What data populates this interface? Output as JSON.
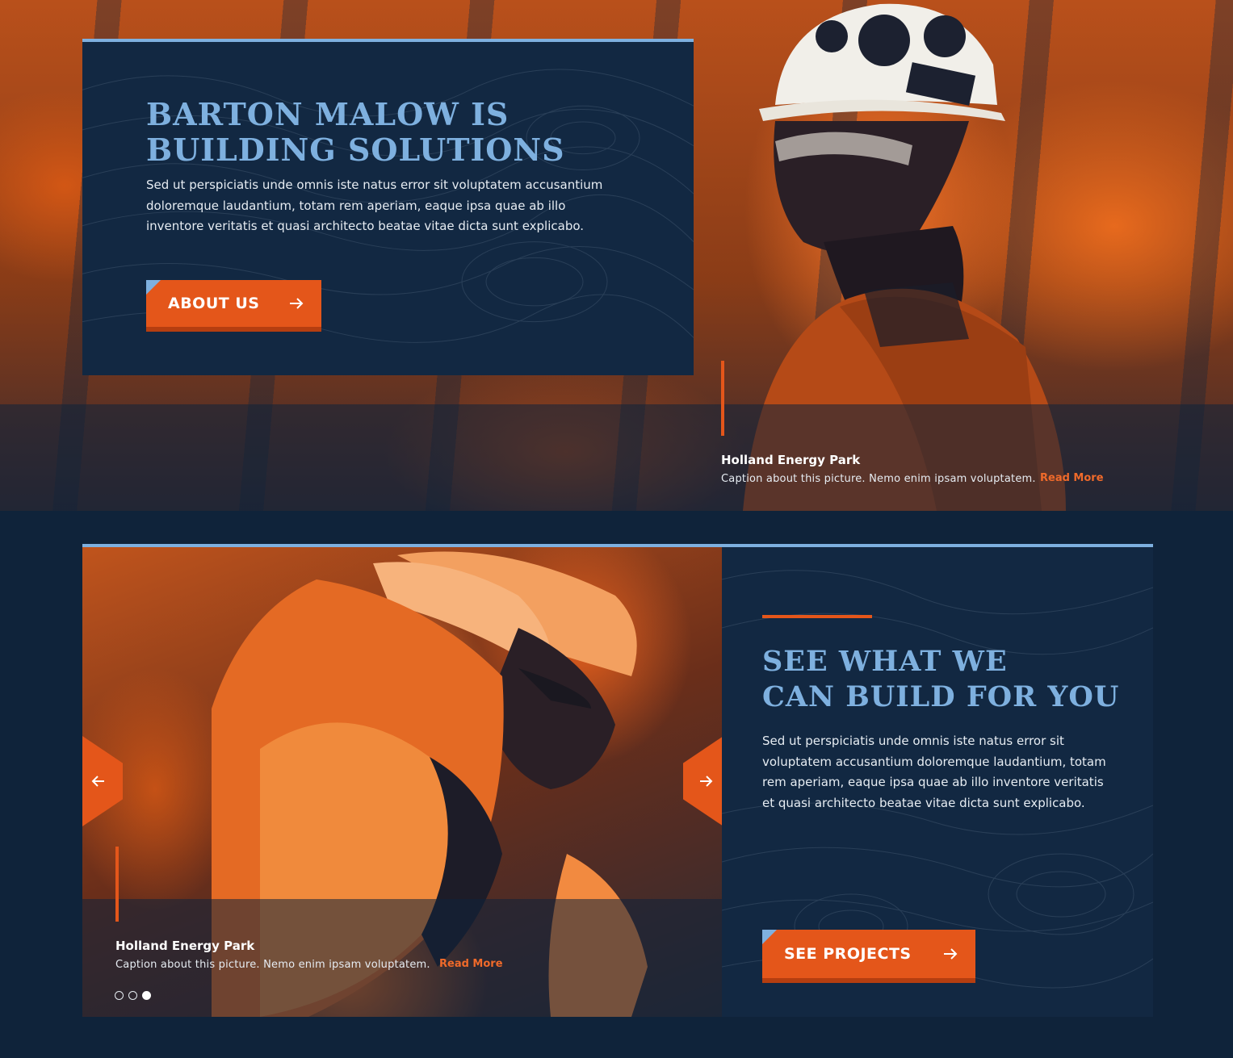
{
  "hero": {
    "heading_line1": "BARTON MALOW IS",
    "heading_line2": "BUILDING SOLUTIONS",
    "body": "Sed ut perspiciatis unde omnis iste natus error sit voluptatem accusantium doloremque laudantium, totam rem aperiam, eaque ipsa quae ab illo inventore veritatis et quasi architecto beatae vitae dicta sunt explicabo.",
    "button_label": "ABOUT US",
    "button_icon": "arrow-right-icon",
    "caption": {
      "title": "Holland Energy Park",
      "text": "Caption about this picture.  Nemo enim ipsam voluptatem.",
      "link": "Read More"
    }
  },
  "projects": {
    "heading_line1": "SEE WHAT WE",
    "heading_line2": "CAN BUILD FOR YOU",
    "body": "Sed ut perspiciatis unde omnis iste natus error sit voluptatem accusantium doloremque laudantium, totam rem aperiam, eaque ipsa quae ab illo inventore veritatis et quasi architecto beatae vitae dicta sunt explicabo.",
    "button_label": "SEE PROJECTS",
    "button_icon": "arrow-right-icon"
  },
  "slider": {
    "prev_icon": "arrow-left-icon",
    "next_icon": "arrow-right-icon",
    "caption": {
      "title": "Holland Energy Park",
      "text": "Caption about this picture.  Nemo enim ipsam voluptatem.",
      "link": "Read More"
    },
    "slide_count": 3,
    "active_slide": 3
  },
  "colors": {
    "background": "#0f233a",
    "panel": "#122842",
    "accent_orange": "#e4561a",
    "accent_blue": "#7eb0df"
  }
}
